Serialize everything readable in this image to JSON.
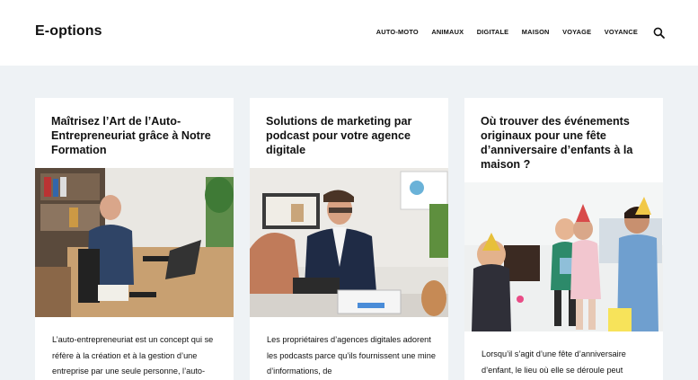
{
  "header": {
    "logo": "E-options",
    "nav": [
      "AUTO-MOTO",
      "ANIMAUX",
      "DIGITALE",
      "MAISON",
      "VOYAGE",
      "VOYANCE"
    ]
  },
  "articles": [
    {
      "title": "Maîtrisez l’Art de l’Auto-Entrepreneuriat grâce à Notre Formation",
      "excerpt": "L’auto-entrepreneuriat est un concept qui se réfère à la création et à la gestion d’une entreprise par une seule personne, l’auto-"
    },
    {
      "title": "Solutions de marketing par podcast pour votre agence digitale",
      "excerpt": "Les propriétaires d’agences digitales adorent les podcasts parce qu’ils fournissent une mine d’informations, de"
    },
    {
      "title": "Où trouver des événements originaux pour une fête d’anniversaire d’enfants à la maison ?",
      "excerpt": "Lorsqu’il s’agit d’une fête d’anniversaire d’enfant, le lieu où elle se déroule peut"
    }
  ]
}
